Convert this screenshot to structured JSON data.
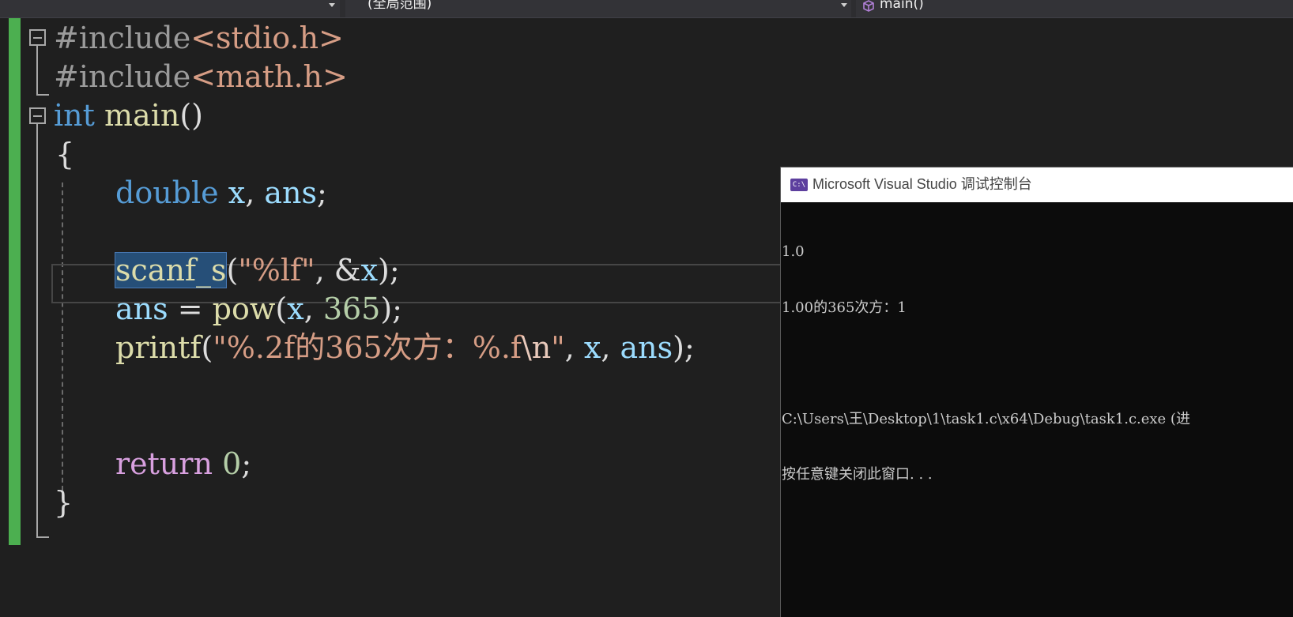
{
  "navbar": {
    "scope_combo": "(全局范围)",
    "member_combo": "main()"
  },
  "editor": {
    "line1": {
      "directive": "#include",
      "header": "<stdio.h>"
    },
    "line2": {
      "directive": "#include",
      "header": "<math.h>"
    },
    "line3": {
      "type": "int",
      "name": "main",
      "parens": "()"
    },
    "line4": {
      "brace": "{"
    },
    "line5": {
      "type": "double",
      "var1": "x",
      "comma": ", ",
      "var2": "ans",
      "semi": ";"
    },
    "line6": {
      "fn": "scanf_s",
      "open": "(",
      "format": "\"%lf\"",
      "sep": ", ",
      "amp": "&",
      "var": "x",
      "close": ");"
    },
    "line7": {
      "var1": "ans",
      "assign": " = ",
      "fn": "pow",
      "open": "(",
      "var2": "x",
      "comma": ", ",
      "num": "365",
      "close": ");"
    },
    "line8": {
      "fn": "printf",
      "open": "(",
      "format_a": "\"%.2f的365次方：%.f",
      "escape": "\\n",
      "format_b": "\"",
      "sep1": ", ",
      "var1": "x",
      "sep2": ", ",
      "var2": "ans",
      "close": ");"
    },
    "line11": {
      "kw": "return",
      "space": " ",
      "num": "0",
      "semi": ";"
    },
    "line12": {
      "brace": "}"
    }
  },
  "console": {
    "title": "Microsoft Visual Studio 调试控制台",
    "icon_label": "C:\\",
    "lines": [
      "1.0",
      "1.00的365次方：1",
      "",
      "C:\\Users\\王\\Desktop\\1\\task1.c\\x64\\Debug\\task1.c.exe (进",
      "按任意键关闭此窗口. . ."
    ]
  },
  "colors": {
    "change_bar": "#4caf50",
    "keyword": "#569cd6",
    "function": "#dcdcaa",
    "variable": "#9cdcfe",
    "string": "#d69d85",
    "number": "#b5cea8",
    "control": "#d8a0df",
    "selection": "#264f78",
    "console_icon": "#5d3f9e"
  }
}
